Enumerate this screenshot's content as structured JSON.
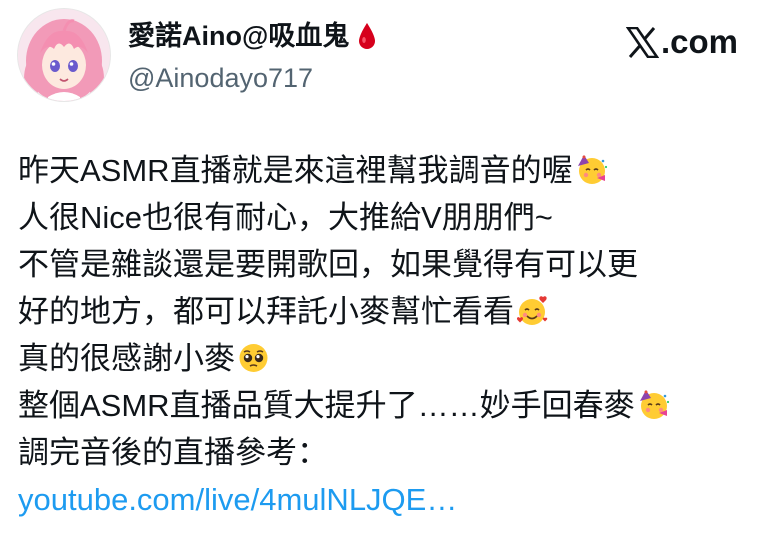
{
  "author": {
    "display_name": "愛諾Aino@吸血鬼",
    "handle": "@Ainodayo717",
    "name_icon": "blood-drop-icon"
  },
  "brand": {
    "text": ".com",
    "icon": "x-logo-icon"
  },
  "tweet": {
    "lines": [
      "昨天ASMR直播就是來這裡幫我調音的喔",
      "人很Nice也很有耐心，大推給V朋朋們~",
      "不管是雜談還是要開歌回，如果覺得有可以更",
      "好的地方，都可以拜託小麥幫忙看看",
      "真的很感謝小麥",
      "整個ASMR直播品質大提升了……妙手回春麥",
      "調完音後的直播參考："
    ],
    "link": "youtube.com/live/4mulNLJQE…",
    "emojis": {
      "line1": "partying-face-icon",
      "line4": "smiling-face-with-hearts-icon",
      "line5": "pleading-face-icon",
      "line6": "partying-face-icon"
    }
  },
  "colors": {
    "text": "#0f1419",
    "secondary": "#536471",
    "link": "#1d9bf0",
    "drop": "#d6001c"
  }
}
